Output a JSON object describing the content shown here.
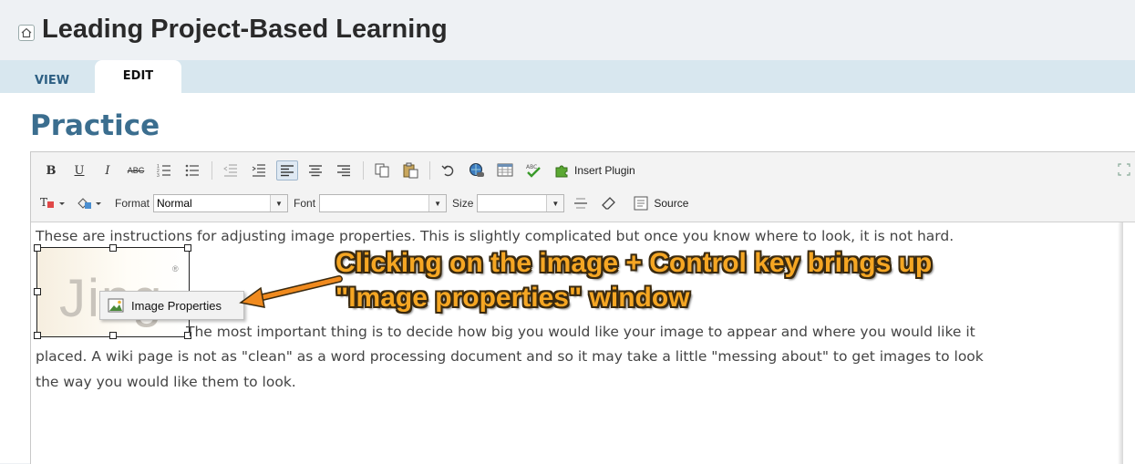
{
  "header": {
    "title": "Leading Project-Based Learning",
    "home_icon": "home-icon"
  },
  "tabs": [
    {
      "label": "VIEW"
    },
    {
      "label": "EDIT"
    }
  ],
  "page": {
    "heading": "Practice"
  },
  "toolbar": {
    "bold": "B",
    "underline": "U",
    "italic": "I",
    "strike": "ABC",
    "insert_plugin": "Insert Plugin",
    "format_label": "Format",
    "format_value": "Normal",
    "font_label": "Font",
    "font_value": "",
    "size_label": "Size",
    "size_value": "",
    "source": "Source"
  },
  "editor": {
    "para1": "These are instructions for adjusting image properties.  This is slightly complicated but once you know where to look, it is not hard.",
    "para2_line1": "The most important thing is to decide how big you would like your image to appear and where you would like it",
    "para2_line2": "placed.  A wiki page is not as \"clean\" as a word processing document and so it may take a little \"messing about\" to get images to look",
    "para2_line3": "the way you would like them to look.",
    "image_text": "Jing",
    "image_reg": "®"
  },
  "context_menu": {
    "item": "Image Properties"
  },
  "annotation": {
    "line1": "Clicking on the image + Control key brings up",
    "line2": "\"Image properties\" window",
    "color": "#f5a623"
  }
}
